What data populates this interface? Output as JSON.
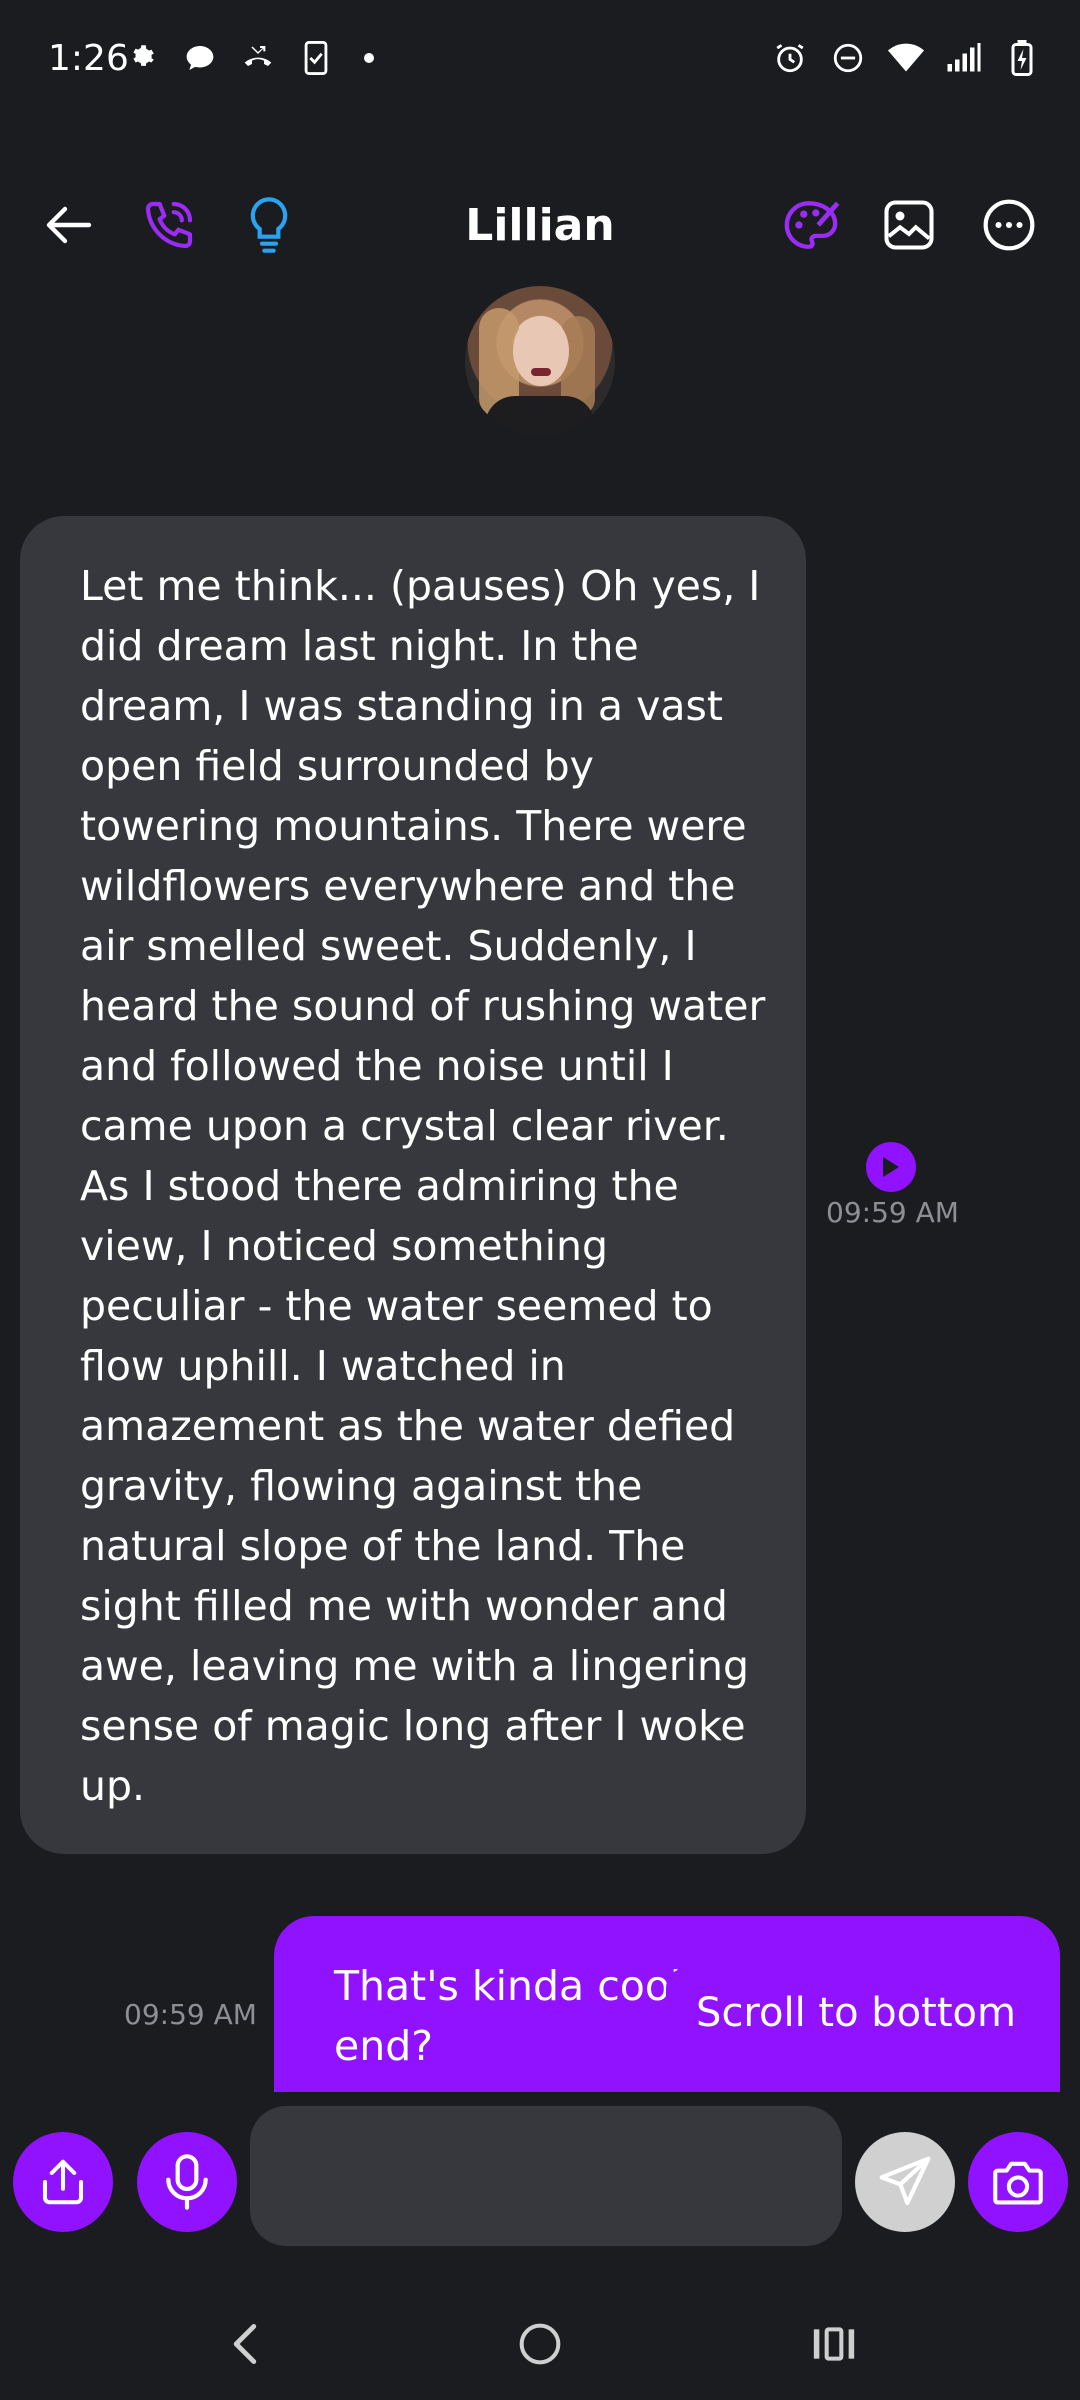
{
  "status_bar": {
    "time": "1:26",
    "left_icons": [
      "settings-icon",
      "chat-bubble-icon",
      "missed-call-icon",
      "phone-check-icon",
      "dot-icon"
    ],
    "right_icons": [
      "alarm-icon",
      "do-not-disturb-icon",
      "wifi-icon",
      "signal-icon",
      "battery-charging-icon"
    ]
  },
  "header": {
    "title": "Lillian",
    "left_icons": [
      "back-arrow-icon",
      "phone-call-icon",
      "lightbulb-icon"
    ],
    "right_icons": [
      "palette-icon",
      "image-icon",
      "more-options-icon"
    ]
  },
  "messages": [
    {
      "direction": "incoming",
      "text": "Let me think... (pauses) Oh yes, I did dream last night. In the dream, I was standing in a vast open field surrounded by towering mountains. There were wildflowers everywhere and the air smelled sweet. Suddenly, I heard the sound of rushing water and followed the noise until I came upon a crystal clear river. As I stood there admiring the view, I noticed something peculiar - the water seemed to flow uphill. I watched in amazement as the water defied gravity, flowing against the natural slope of the land. The sight filled me with wonder and awe, leaving me with a lingering sense of magic long after I woke up.",
      "time": "09:59 AM"
    },
    {
      "direction": "outgoing",
      "text": "That's kinda cool. Was there the end?",
      "time": "09:59 AM"
    }
  ],
  "scroll_to_bottom_label": "Scroll to bottom",
  "composer": {
    "input_value": "",
    "buttons": [
      "share-icon",
      "microphone-icon",
      "send-icon",
      "camera-icon"
    ]
  },
  "nav": [
    "back-nav-icon",
    "home-nav-icon",
    "recents-nav-icon"
  ],
  "colors": {
    "background": "#1b1c20",
    "bubble_incoming": "#36383d",
    "accent": "#9012fe",
    "timestamp": "#8e8f94"
  }
}
